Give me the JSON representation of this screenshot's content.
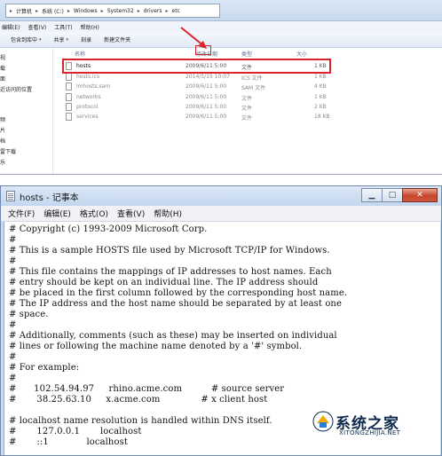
{
  "explorer": {
    "address_parts": [
      "计算机",
      "系统 (C:)",
      "Windows",
      "System32",
      "drivers",
      "etc"
    ],
    "menu": [
      "编辑(E)",
      "查看(V)",
      "工具(T)",
      "帮助(H)"
    ],
    "toolbar": [
      "包含到库中",
      "共享",
      "刻录",
      "新建文件夹"
    ],
    "nav_items": [
      "视",
      "载",
      "面",
      "近访问的位置",
      "频",
      "片",
      "档",
      "雷下载",
      "乐"
    ],
    "columns": {
      "name": "名称",
      "modified": "修改日期",
      "type": "类型",
      "size": "大小"
    },
    "files": [
      {
        "name": "hosts",
        "modified": "2009/6/11 5:00",
        "type": "文件",
        "size": "1 KB"
      },
      {
        "name": "hosts.ics",
        "modified": "2014/5/15 10:07",
        "type": "ICS 文件",
        "size": "1 KB"
      },
      {
        "name": "lmhosts.sam",
        "modified": "2009/6/11 5:00",
        "type": "SAM 文件",
        "size": "4 KB"
      },
      {
        "name": "networks",
        "modified": "2009/6/11 5:00",
        "type": "文件",
        "size": "1 KB"
      },
      {
        "name": "protocol",
        "modified": "2009/6/11 5:00",
        "type": "文件",
        "size": "2 KB"
      },
      {
        "name": "services",
        "modified": "2009/6/11 5:00",
        "type": "文件",
        "size": "18 KB"
      }
    ]
  },
  "notepad": {
    "title": "hosts - 记事本",
    "menu": [
      "文件(F)",
      "编辑(E)",
      "格式(O)",
      "查看(V)",
      "帮助(H)"
    ],
    "lines": [
      "# Copyright (c) 1993-2009 Microsoft Corp.",
      "#",
      "# This is a sample HOSTS file used by Microsoft TCP/IP for Windows.",
      "#",
      "# This file contains the mappings of IP addresses to host names. Each",
      "# entry should be kept on an individual line. The IP address should",
      "# be placed in the first column followed by the corresponding host name.",
      "# The IP address and the host name should be separated by at least one",
      "# space.",
      "#",
      "# Additionally, comments (such as these) may be inserted on individual",
      "# lines or following the machine name denoted by a '#' symbol.",
      "#",
      "# For example:",
      "#",
      "#      102.54.94.97     rhino.acme.com          # source server",
      "#       38.25.63.10     x.acme.com              # x client host",
      "",
      "# localhost name resolution is handled within DNS itself.",
      "#       127.0.0.1       localhost",
      "#       ::1             localhost"
    ]
  },
  "watermark": {
    "name": "系统之家",
    "url": "XITONGZHIJIA.NET"
  },
  "colors": {
    "highlight": "#d9232d",
    "title_bar": "#c3d6ee",
    "close_button": "#c6452c"
  }
}
